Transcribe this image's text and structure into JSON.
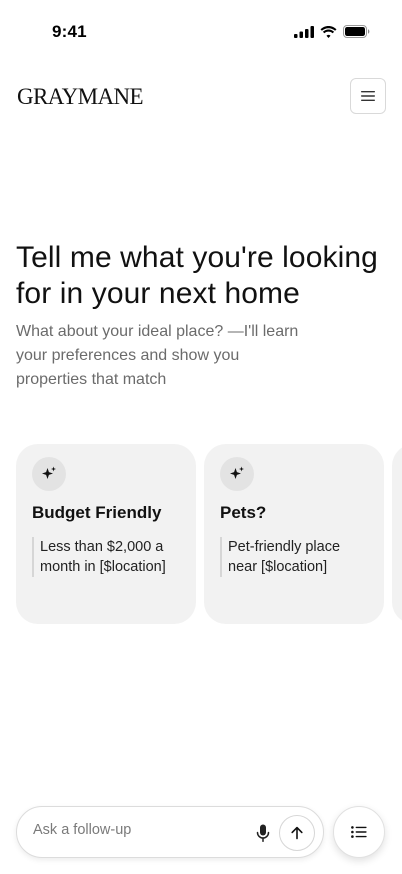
{
  "status_bar": {
    "time": "9:41",
    "icons": [
      "cellular-signal-icon",
      "wifi-icon",
      "battery-icon"
    ]
  },
  "header": {
    "logo": "GRAYMANE",
    "menu_icon": "hamburger-menu-icon"
  },
  "hero": {
    "title": "Tell me what you're looking for in your next home",
    "subtitle": "What about your ideal place? —I'll learn your preferences and show you properties that match"
  },
  "suggestions": [
    {
      "icon": "sparkle-icon",
      "title": "Budget Friendly",
      "body": "Less than $2,000 a month in [$location]"
    },
    {
      "icon": "sparkle-icon",
      "title": "Pets?",
      "body": "Pet-friendly place near [$location]"
    }
  ],
  "composer": {
    "placeholder": "Ask a follow-up",
    "value": "",
    "mic_icon": "microphone-icon",
    "send_icon": "arrow-up-icon"
  },
  "list_button": {
    "icon": "list-icon"
  }
}
